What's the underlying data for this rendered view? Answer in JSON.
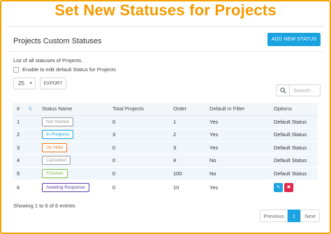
{
  "headline": "Set New Statuses for Projects",
  "panel": {
    "title": "Projects Custom Statuses",
    "add_button": "ADD NEW STATUS",
    "caption": "List of all statuses of Projects.",
    "checkbox_label": "Enable to edit default Status for Projects"
  },
  "controls": {
    "page_size": "25",
    "export_label": "EXPORT",
    "search_placeholder": "Search..."
  },
  "table": {
    "headers": [
      "#",
      "Status Name",
      "Total Projects",
      "Order",
      "Default in Filter",
      "Options"
    ],
    "rows": [
      {
        "num": "1",
        "status": "Not Started",
        "status_color": "#999999",
        "total": "0",
        "order": "1",
        "default": "Yes",
        "options": "Default Status"
      },
      {
        "num": "2",
        "status": "In Progress",
        "status_color": "#1aa3e0",
        "total": "3",
        "order": "2",
        "default": "Yes",
        "options": "Default Status"
      },
      {
        "num": "3",
        "status": "On Hold",
        "status_color": "#f07b2b",
        "total": "0",
        "order": "3",
        "default": "Yes",
        "options": "Default Status"
      },
      {
        "num": "4",
        "status": "Cancelled",
        "status_color": "#999999",
        "total": "0",
        "order": "4",
        "default": "No",
        "options": "Default Status"
      },
      {
        "num": "5",
        "status": "Finished",
        "status_color": "#7cc04b",
        "total": "0",
        "order": "100",
        "default": "No",
        "options": "Default Status"
      },
      {
        "num": "6",
        "status": "Awaiting Response",
        "status_color": "#5b3fa8",
        "total": "0",
        "order": "10",
        "default": "Yes",
        "options": ""
      }
    ]
  },
  "footer": {
    "entries_info": "Showing 1 to 6 of 6 entries",
    "prev_label": "Previous",
    "current_page": "1",
    "next_label": "Next"
  },
  "colors": {
    "accent": "#1aa3e0",
    "headline": "#f59a00",
    "delete": "#e0294a"
  },
  "icons": {
    "sort": "sort-icon",
    "search": "search-icon",
    "edit": "pencil-icon",
    "delete": "close-icon"
  }
}
